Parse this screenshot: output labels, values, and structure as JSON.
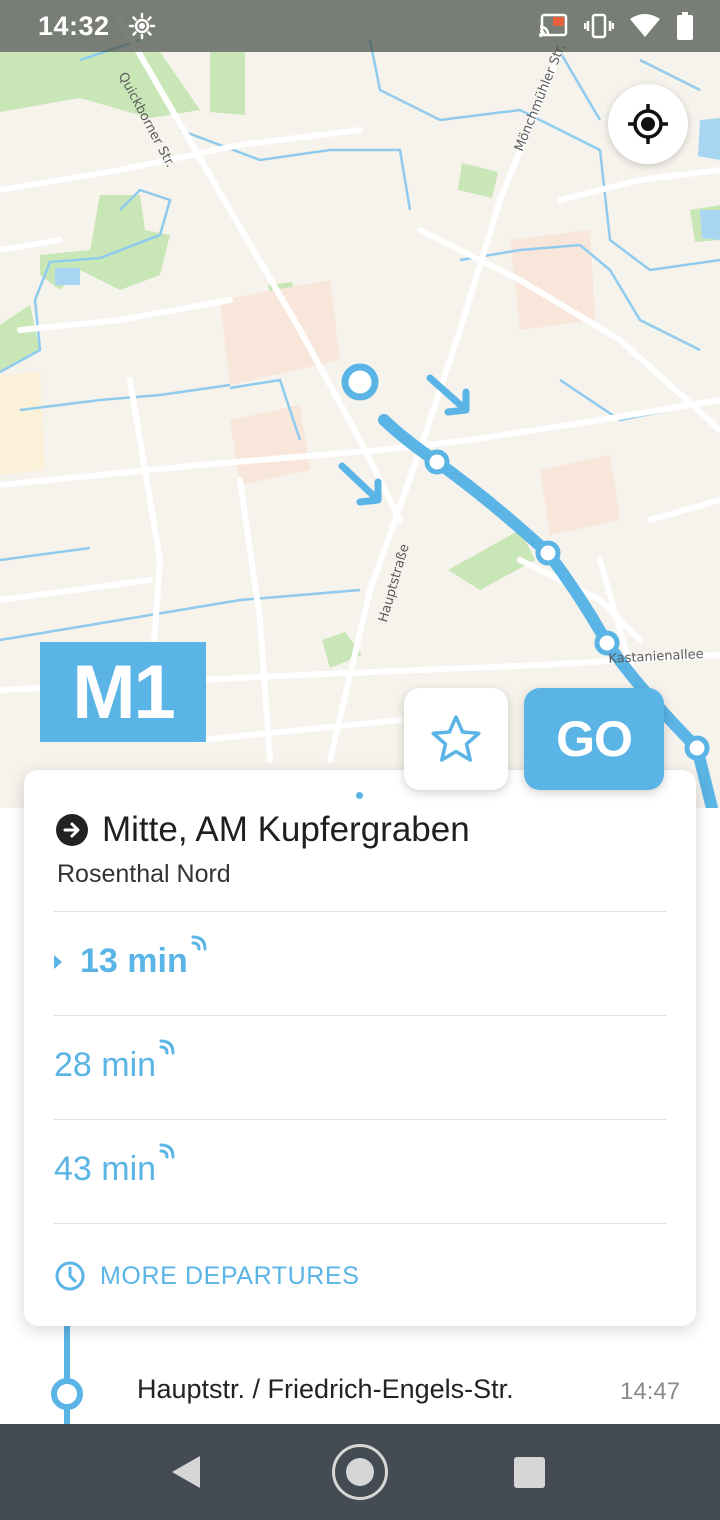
{
  "status_bar": {
    "time": "14:32",
    "icons": [
      "brightness-icon",
      "cast-icon",
      "vibrate-icon",
      "wifi-icon",
      "battery-icon"
    ]
  },
  "map": {
    "street_labels": {
      "quickborner": "Quickborner Str.",
      "moenchmuehler": "Mönchmühler Str.",
      "hauptstrasse": "Hauptstraße",
      "kastanienallee": "Kastanienallee"
    },
    "route_color": "#5ab4e5"
  },
  "line": {
    "label": "M1",
    "color": "#5ab4e5"
  },
  "actions": {
    "go_label": "GO",
    "favorite_icon": "star-icon"
  },
  "card": {
    "destination": "Mitte, AM Kupfergraben",
    "origin": "Rosenthal Nord",
    "departures": [
      {
        "label": "13 min",
        "realtime": true
      },
      {
        "label": "28 min",
        "realtime": true
      },
      {
        "label": "43 min",
        "realtime": true
      }
    ],
    "more_label": "MORE DEPARTURES"
  },
  "stops": [
    {
      "name": "Hauptstr. / Friedrich-Engels-Str.",
      "time": "14:47"
    }
  ]
}
